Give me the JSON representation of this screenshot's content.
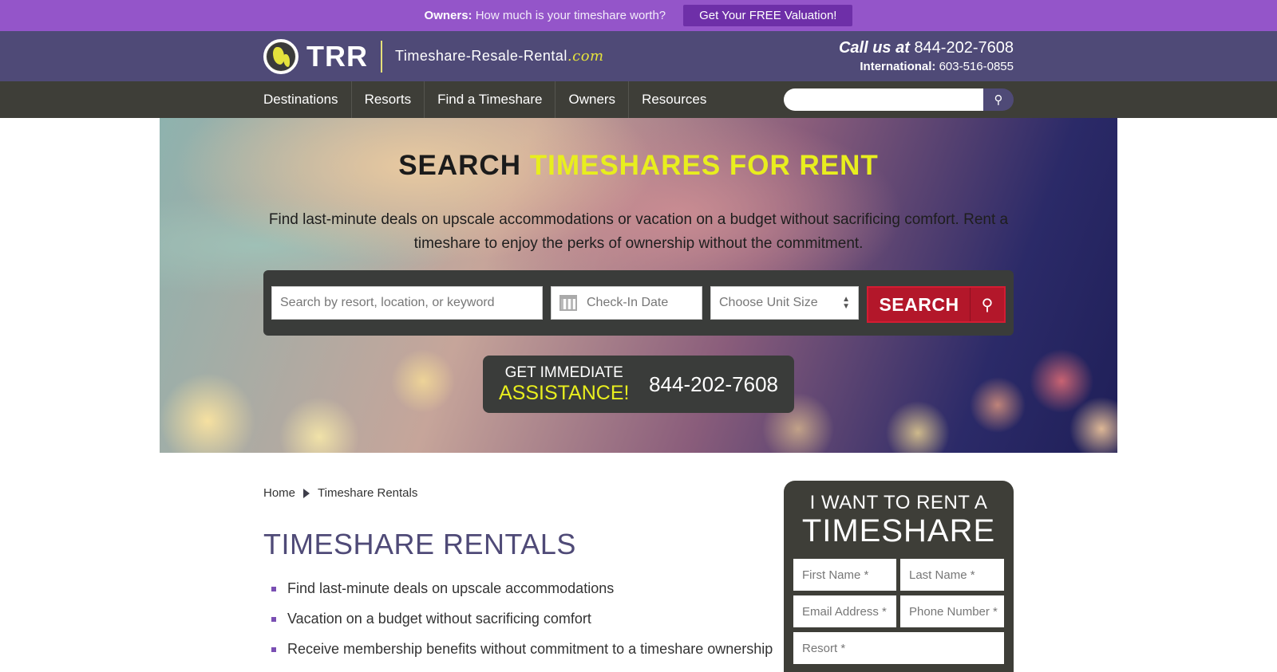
{
  "promo": {
    "owners_label": "Owners:",
    "question": "How much is your timeshare worth?",
    "button": "Get Your FREE Valuation!"
  },
  "header": {
    "logo_abbr": "TRR",
    "logo_domain": "Timeshare-Resale-Rental",
    "logo_tld": ".com",
    "call_label": "Call us at",
    "call_phone": "844-202-7608",
    "intl_label": "International:",
    "intl_phone": "603-516-0855"
  },
  "nav": {
    "items": [
      {
        "label": "Destinations"
      },
      {
        "label": "Resorts"
      },
      {
        "label": "Find a Timeshare"
      },
      {
        "label": "Owners"
      },
      {
        "label": "Resources"
      }
    ],
    "search_placeholder": ""
  },
  "hero": {
    "title_part1": "SEARCH",
    "title_part2": "TIMESHARES FOR RENT",
    "description": "Find last-minute deals on upscale accommodations or vacation on a budget without sacrificing comfort. Rent a timeshare to enjoy the perks of ownership without the commitment.",
    "keyword_placeholder": "Search by resort, location, or keyword",
    "checkin_placeholder": "Check-In Date",
    "unit_size_value": "Choose Unit Size",
    "search_button": "SEARCH",
    "assist_line1": "GET IMMEDIATE",
    "assist_line2": "ASSISTANCE!",
    "assist_phone": "844-202-7608"
  },
  "content": {
    "breadcrumb": [
      "Home",
      "Timeshare Rentals"
    ],
    "title": "TIMESHARE RENTALS",
    "bullets": [
      "Find last-minute deals on upscale accommodations",
      "Vacation on a budget without sacrificing comfort",
      "Receive membership benefits without commitment to a timeshare ownership"
    ]
  },
  "rent_form": {
    "heading_line1": "I WANT TO RENT A",
    "heading_line2": "TIMESHARE",
    "first_name": "First Name *",
    "last_name": "Last Name *",
    "email": "Email Address *",
    "phone": "Phone Number *",
    "resort": "Resort *"
  },
  "colors": {
    "promo_bg": "#9455c9",
    "header_bg": "#4f4a77",
    "nav_bg": "#3e3e38",
    "accent_yellow": "#e8ee1e",
    "search_red": "#b3172a"
  },
  "icons": [
    "globe-logo-icon",
    "search-icon",
    "calendar-icon",
    "select-arrows-icon",
    "magnifier-icon"
  ]
}
